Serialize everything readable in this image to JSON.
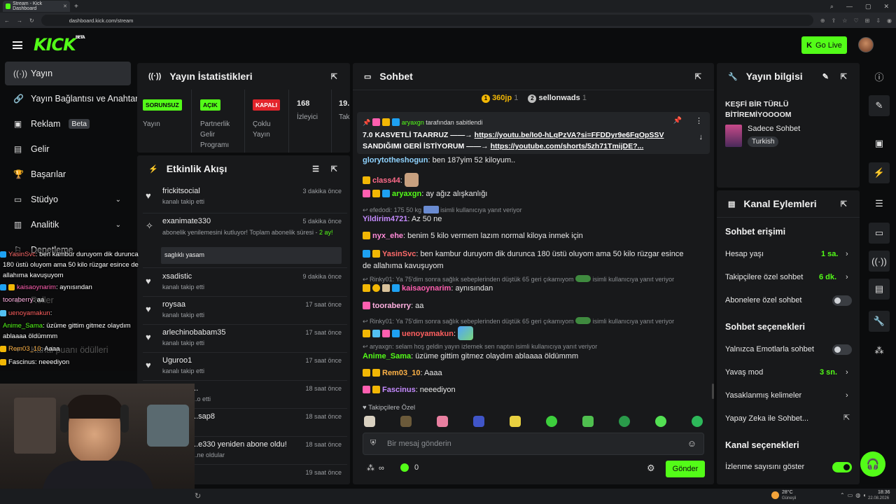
{
  "browser": {
    "tab_title": "Stream - Kick Dashboard",
    "url": "dashboard.kick.com/stream"
  },
  "header": {
    "logo": "KICK",
    "logo_badge": "BETA",
    "go_live": "Go Live"
  },
  "sidebar": {
    "items": [
      {
        "label": "Yayın",
        "icon": "broadcast-icon"
      },
      {
        "label": "Yayın Bağlantısı ve Anahtar",
        "icon": "link-icon"
      },
      {
        "label": "Reklam",
        "badge": "Beta",
        "icon": "ad-icon"
      },
      {
        "label": "Gelir",
        "icon": "revenue-icon"
      },
      {
        "label": "Başarılar",
        "icon": "trophy-icon"
      },
      {
        "label": "Stüdyo",
        "icon": "studio-icon"
      },
      {
        "label": "Analitik",
        "icon": "analytics-icon"
      },
      {
        "label": "Denetleme",
        "icon": "moderation-icon"
      },
      {
        "label": "Roller",
        "icon": "roles-icon"
      },
      {
        "label": "Kanal puanı ödülleri",
        "icon": "rewards-icon"
      }
    ]
  },
  "stats": {
    "title": "Yayın İstatistikleri",
    "items": [
      {
        "chip": "SORUNSUZ",
        "label": "Yayın"
      },
      {
        "chip": "AÇIK",
        "label": "Partnerlik Gelir Programı"
      },
      {
        "chip": "KAPALI",
        "label": "Çoklu Yayın"
      },
      {
        "value": "168",
        "label": "İzleyici"
      },
      {
        "value": "19.",
        "label": "Tak"
      }
    ]
  },
  "activity": {
    "title": "Etkinlik Akışı",
    "items": [
      {
        "name": "frickitsocial",
        "sub": "kanalı takip etti",
        "time": "3 dakika önce"
      },
      {
        "name": "exanimate330",
        "sub": "abonelik yenilemesini kutluyor! Toplam abonelik süresi - ",
        "sub_strong": "2 ay!",
        "time": "5 dakika önce",
        "message": "saglıklı yasam"
      },
      {
        "name": "xsadistic",
        "sub": "kanalı takip etti",
        "time": "9 dakika önce"
      },
      {
        "name": "roysaa",
        "sub": "kanalı takip etti",
        "time": "17 saat önce"
      },
      {
        "name": "arlechinobabam35",
        "sub": "kanalı takip etti",
        "time": "17 saat önce"
      },
      {
        "name": "Uguroo1",
        "sub": "kanalı takip etti",
        "time": "17 saat önce"
      },
      {
        "name": "...",
        "sub": "...o etti",
        "time": "18 saat önce"
      },
      {
        "name": "...sap8",
        "sub": "",
        "time": "18 saat önce"
      },
      {
        "name": "...e330 yeniden abone oldu!",
        "sub": "...ne oldular",
        "time": "18 saat önce"
      },
      {
        "name": "",
        "sub": "",
        "time": "19 saat önce"
      }
    ]
  },
  "chat": {
    "title": "Sohbet",
    "top_gifters": [
      {
        "name": "360jp",
        "count": "1"
      },
      {
        "name": "sellonwads",
        "count": "1"
      }
    ],
    "pinned_by": "aryaxgn",
    "pinned_suffix": "tarafından sabitlendi",
    "pinned_line1_text": "7.0 KASVETLİ TAARRUZ ——→ ",
    "pinned_line1_link": "https://youtu.be/Io0-hLqPzVA?si=FFDDyr9e6FqOpSSV",
    "pinned_line2_text": "SANDIĞIMI GERİ İSTİYORUM ——→ ",
    "pinned_line2_link": "https://youtube.com/shorts/5zh71TmijDE?...",
    "messages": [
      {
        "user": "glorytotheshogun",
        "text": ": ben 187yim 52 kiloyum..",
        "color": "#8fd3ff"
      },
      {
        "user": "class44",
        "text": ":",
        "color": "#ff6b8a"
      },
      {
        "user": "aryaxgn",
        "text": ": ay ağız alışkanlığı",
        "color": "#53fc18"
      },
      {
        "user": "Yildirim4721",
        "text": ": Az 50 ne",
        "color": "#c58bff"
      },
      {
        "user": "nyx_ehe",
        "text": ": benim 5 kilo vermem lazım normal kiloya inmek için",
        "color": "#ff8ad8"
      },
      {
        "user": "YasinSvc",
        "text": ": ben kambur duruyom dik durunca 180 üstü oluyom ama 50 kilo rüzgar esince",
        "text2": "de allahıma kavuşuyom",
        "color": "#ff6b6b"
      },
      {
        "user": "kaisaoynarim",
        "text": ": aynısından",
        "color": "#ff5fb0"
      },
      {
        "user": "tooraberry",
        "text": ": aa",
        "color": "#ffb0e0"
      },
      {
        "user": "uenoyamakun",
        "text": ":",
        "color": "#ff5f5f"
      },
      {
        "user": "Anime_Sama",
        "text": ": üzüme gittim gitmez olaydım ablaaaa öldümmm",
        "color": "#53fc18"
      },
      {
        "user": "Rem03_10",
        "text": ": Aaaa",
        "color": "#ffb347"
      },
      {
        "user": "Fascinus",
        "text": ": neeediyon",
        "color": "#c58bff"
      }
    ],
    "replies": [
      "efedodi: 175 50 kg",
      "isimli kullanıcıya yanıt veriyor",
      "Rinky01: Ya 75'dim sonra sağlık sebeplerinden düştük 65 geri çıkamıyom",
      "isimli kullanıcıya yanıt veriyor",
      "Rinky01: Ya 75'dim sonra sağlık sebeplerinden düştük 65 geri çıkamıyom",
      "isimli kullanıcıya yanıt veriyor",
      "aryaxgn: selam hoş geldin yayın izlemek sen naptın isimli kullanıcıya yanıt veriyor"
    ],
    "emote_tab": "Takipçilere Özel",
    "input_placeholder": "Bir mesaj gönderin",
    "points": "∞",
    "kicks": "0",
    "send": "Gönder"
  },
  "stream_info": {
    "title": "Yayın bilgisi",
    "stream_title": "KEŞFİ BİR TÜRLÜ BİTİREMİYOOOOM",
    "category": "Sadece Sohbet",
    "language": "Turkish"
  },
  "channel_actions": {
    "title": "Kanal Eylemleri",
    "chat_access": "Sohbet erişimi",
    "account_age": {
      "label": "Hesap yaşı",
      "value": "1 sa."
    },
    "followers_only": {
      "label": "Takipçilere özel sohbet",
      "value": "6 dk."
    },
    "subscribers_only": {
      "label": "Abonelere özel sohbet",
      "on": false
    },
    "chat_options": "Sohbet seçenekleri",
    "emote_only": {
      "label": "Yalnızca Emotlarla sohbet",
      "on": false
    },
    "slow_mode": {
      "label": "Yavaş mod",
      "value": "3 sn."
    },
    "banned_words": "Yasaklanmış kelimeler",
    "ai_moderation": "Yapay Zeka ile Sohbet...",
    "channel_options": "Kanal seçenekleri",
    "show_viewers": {
      "label": "İzlenme sayısını göster",
      "on": true
    }
  },
  "overlay_chat": [
    {
      "user": "YasinSvc",
      "text": ": ben kambur duruyom dik durunca"
    },
    {
      "user": "",
      "text": "180 üstü oluyom ama 50 kilo rüzgar esince de"
    },
    {
      "user": "",
      "text": "allahıma kavuşuyom"
    },
    {
      "user": "kaisaoynarim",
      "text": ": aynısından"
    },
    {
      "user": "tooraberry",
      "text": ": aa"
    },
    {
      "user": "uenoyamakun",
      "text": ":"
    },
    {
      "user": "Anime_Sama",
      "text": ": üzüme gittim gitmez olaydım"
    },
    {
      "user": "",
      "text": "ablaaaa öldümmm"
    },
    {
      "user": "Rem03_10",
      "text": ": Aaaa"
    },
    {
      "user": "Fascinus",
      "text": ": neeediyon"
    }
  ],
  "taskbar": {
    "weather_temp": "28°C",
    "weather_desc": "Güneşli",
    "time": "18:36",
    "date": "22.08.2026"
  },
  "colors": {
    "brand": "#53fc18",
    "panel": "#18191b",
    "bg": "#0b0c0d"
  }
}
